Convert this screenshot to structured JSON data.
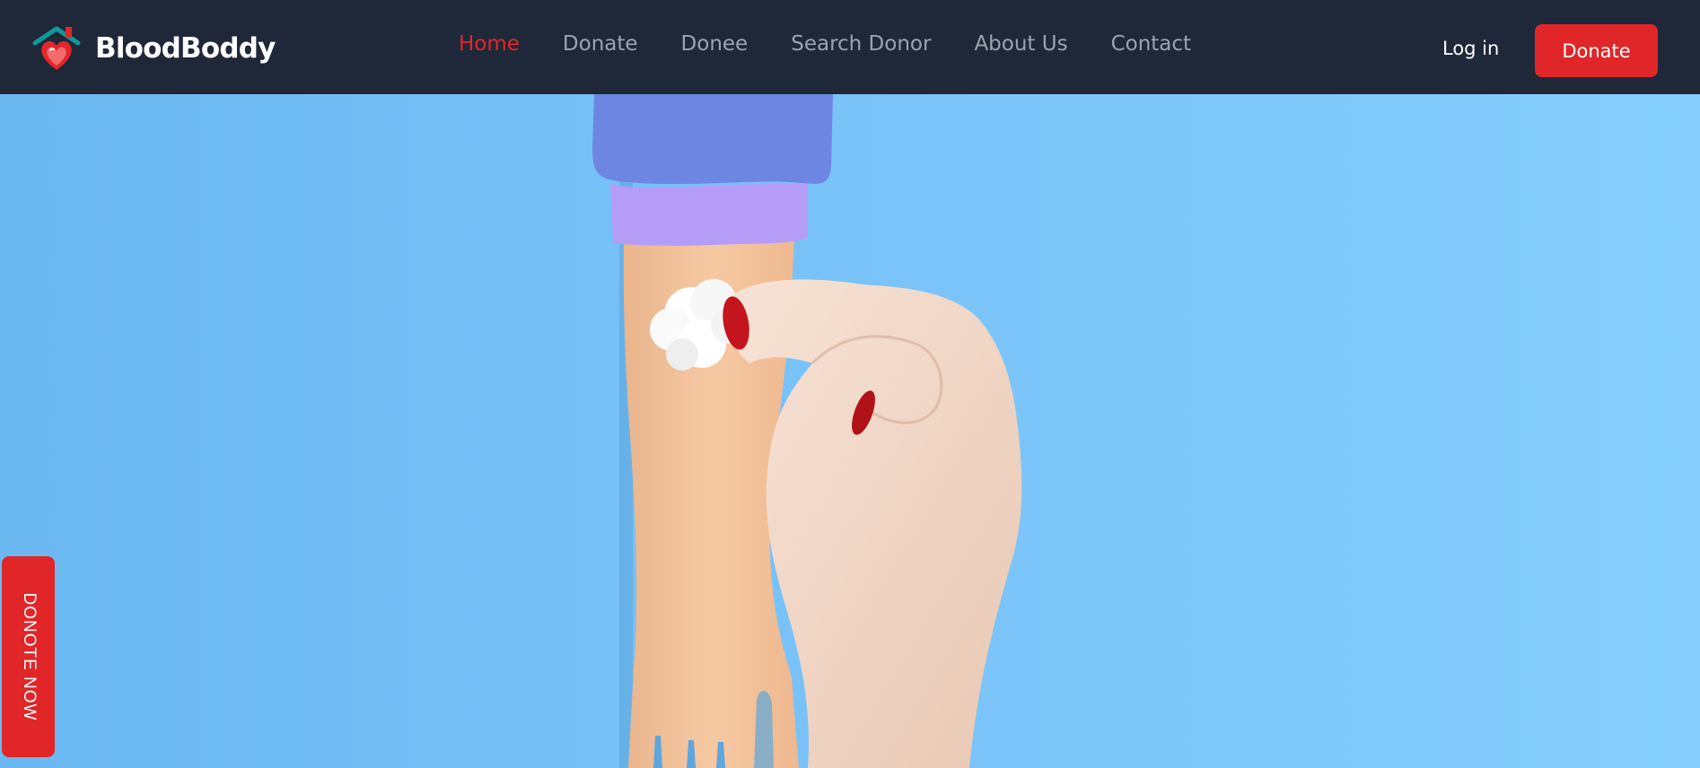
{
  "brand": {
    "name": "BloodBoddy",
    "logo_icon": "heart-house-icon"
  },
  "nav": {
    "items": [
      {
        "label": "Home",
        "active": true
      },
      {
        "label": "Donate",
        "active": false
      },
      {
        "label": "Donee",
        "active": false
      },
      {
        "label": "Search Donor",
        "active": false
      },
      {
        "label": "About Us",
        "active": false
      },
      {
        "label": "Contact",
        "active": false
      }
    ],
    "login_label": "Log in",
    "donate_label": "Donate"
  },
  "hero": {
    "image": "arm-cotton-swab-illustration",
    "side_button_label": "DONOTE NOW"
  },
  "colors": {
    "navbar_bg": "#1f2838",
    "accent_red": "#e02628",
    "nav_inactive": "#9ca3af",
    "hero_blue": "#78c2f8"
  }
}
